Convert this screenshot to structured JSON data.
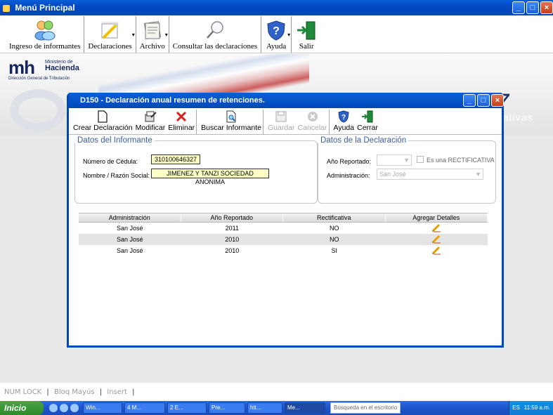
{
  "main_window": {
    "title": "Menú Principal",
    "controls": {
      "minimize": "_",
      "maximize": "□",
      "close": "×"
    }
  },
  "main_toolbar": {
    "items": [
      {
        "label": "Ingreso de informantes",
        "icon": "users-icon"
      },
      {
        "label": "Declaraciones",
        "icon": "pen-document-icon"
      },
      {
        "label": "Archivo",
        "icon": "document-stack-icon"
      },
      {
        "label": "Consultar las declaraciones",
        "icon": "magnifier-icon"
      },
      {
        "label": "Ayuda",
        "icon": "help-shield-icon"
      },
      {
        "label": "Salir",
        "icon": "exit-door-icon"
      }
    ]
  },
  "banner": {
    "logo_mark": "mh",
    "logo_line1": "Ministerio de",
    "logo_line2": "Hacienda",
    "logo_sub": "Dirección General de Tributación",
    "big_right": "7",
    "big_right_sub": "ativas"
  },
  "dialog": {
    "title": "D150 - Declaración anual resumen de retenciones.",
    "toolbar": [
      {
        "label": "Crear Declaración",
        "enabled": true,
        "icon": "new-document-icon"
      },
      {
        "label": "Modificar",
        "enabled": true,
        "icon": "edit-icon"
      },
      {
        "label": "Eliminar",
        "enabled": true,
        "icon": "delete-x-icon"
      },
      {
        "label": "Buscar Informante",
        "enabled": true,
        "icon": "search-document-icon"
      },
      {
        "label": "Guardar",
        "enabled": false,
        "icon": "save-disk-icon"
      },
      {
        "label": "Cancelar",
        "enabled": false,
        "icon": "cancel-icon"
      },
      {
        "label": "Ayuda",
        "enabled": true,
        "icon": "help-shield-icon"
      },
      {
        "label": "Cerrar",
        "enabled": true,
        "icon": "exit-door-icon"
      }
    ],
    "informante": {
      "legend": "Datos del Informante",
      "cedula_label": "Número de Cédula:",
      "cedula_value": "310100646327",
      "nombre_label": "Nombre / Razón Social:",
      "nombre_value": "JIMENEZ Y TANZI SOCIEDAD ANONIMA"
    },
    "declaracion": {
      "legend": "Datos de la Declaración",
      "anio_label": "Año Reportado:",
      "anio_value": "",
      "rectificativa_label": "Es una RECTIFICATIVA",
      "rectificativa_checked": false,
      "admin_label": "Administración:",
      "admin_value": "San José"
    },
    "grid": {
      "columns": [
        "Administración",
        "Año Reportado",
        "Rectificativa",
        "Agregar Detalles"
      ],
      "rows": [
        [
          "San José",
          "2011",
          "NO",
          ""
        ],
        [
          "San José",
          "2010",
          "NO",
          ""
        ],
        [
          "San José",
          "2010",
          "SI",
          ""
        ]
      ]
    }
  },
  "statusbar": {
    "numlock": "NUM LOCK",
    "bloq": "Bloq Mayús",
    "insert": "Insert"
  },
  "taskbar": {
    "start": "Inicio",
    "tasks": [
      "Win...",
      "4 M...",
      "2 E...",
      "Pre...",
      "htt...",
      "Me..."
    ],
    "search_placeholder": "Búsqueda en el escritorio",
    "lang": "ES",
    "time": "11:59 a.m."
  },
  "colors": {
    "xp_blue": "#0148b8",
    "yellow_field": "#ffffc8",
    "legend_blue": "#3b5ea6",
    "close_red": "#c4401a"
  }
}
